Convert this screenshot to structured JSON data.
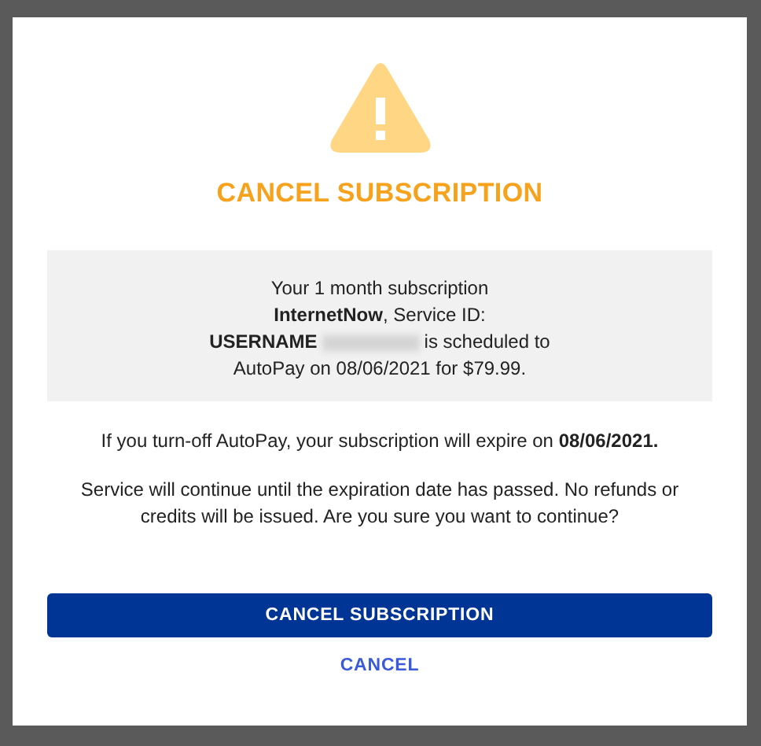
{
  "dialog": {
    "title": "CANCEL SUBSCRIPTION",
    "summary": {
      "line_1": "Your 1 month subscription",
      "line_2": "**InternetNow**, Service ID:",
      "username": "USERNAME",
      "redacted": true,
      "line_3_rest": "is scheduled to",
      "line_4": "AutoPay on 08/06/2021 for $79.99."
    },
    "expiry_notice": "If you turn-off AutoPay, your subscription will expire on **08/06/2021.**",
    "warning": "Service will continue until the expiration date has passed. No refunds or credits will be issued. Are you sure you want to continue?",
    "buttons": [
      {
        "label": "CANCEL SUBSCRIPTION",
        "kind": "primary"
      },
      {
        "label": "CANCEL",
        "kind": "link"
      }
    ]
  }
}
